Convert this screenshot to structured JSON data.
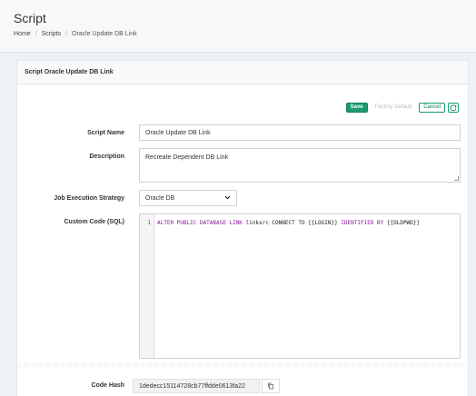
{
  "header": {
    "title": "Script",
    "breadcrumb": [
      "Home",
      "Scripts",
      "Oracle Update DB Link"
    ]
  },
  "card": {
    "title": "Script Oracle Update DB Link"
  },
  "toolbar": {
    "save_label": "Save",
    "factory_default_label": "Factory Default",
    "cancel_label": "Cancel",
    "refresh_icon": "refresh-icon"
  },
  "form": {
    "script_name": {
      "label": "Script Name",
      "value": "Oracle Update DB Link"
    },
    "description": {
      "label": "Description",
      "value": "Recreate Dependent DB Link"
    },
    "job_execution_strategy": {
      "label": "Job Execution Strategy",
      "value": "Oracle DB"
    },
    "custom_code": {
      "label": "Custom Code (SQL)",
      "line_number": "1",
      "tokens": [
        {
          "text": "ALTER PUBLIC DATABASE LINK",
          "kind": "keyword"
        },
        {
          "text": " linksrc CONNECT TO {{LOGIN}} ",
          "kind": "plain"
        },
        {
          "text": "IDENTIFIED BY",
          "kind": "keyword"
        },
        {
          "text": " {{OLDPWD}}",
          "kind": "plain"
        }
      ]
    },
    "code_hash": {
      "label": "Code Hash",
      "value": "1dedecc15114728cb77ffdde0613fa22"
    }
  },
  "colors": {
    "accent": "#1a9a6e",
    "keyword": "#8a1a9a"
  }
}
